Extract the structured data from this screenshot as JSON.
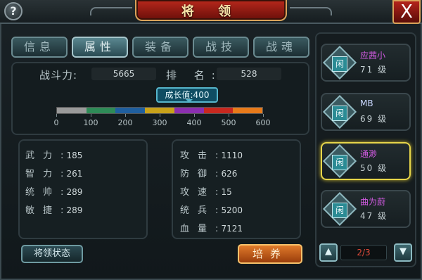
{
  "header": {
    "title": "将 领",
    "help_label": "?",
    "close_label": "X"
  },
  "tabs": [
    {
      "label": "信息"
    },
    {
      "label": "属性"
    },
    {
      "label": "装备"
    },
    {
      "label": "战技"
    },
    {
      "label": "战魂"
    }
  ],
  "summary": {
    "power_label": "战斗力:",
    "power_value": "5665",
    "rank_label": "排 名:",
    "rank_value": "528"
  },
  "growth": {
    "tooltip": "成长值:400",
    "value": 400,
    "max": 600,
    "ticks": [
      "0",
      "100",
      "200",
      "300",
      "400",
      "500",
      "600"
    ],
    "segment_colors": [
      "#9a9a9a",
      "#2e8b57",
      "#1f5f9f",
      "#c8a21a",
      "#8b2fb0",
      "#c8281f",
      "#e87a1a"
    ]
  },
  "left_stats": [
    {
      "label": "武力",
      "value": "185"
    },
    {
      "label": "智力",
      "value": "261"
    },
    {
      "label": "统帅",
      "value": "289"
    },
    {
      "label": "敏捷",
      "value": "289"
    }
  ],
  "right_stats": [
    {
      "label": "攻击",
      "value": "1110"
    },
    {
      "label": "防御",
      "value": "626"
    },
    {
      "label": "攻速",
      "value": "15"
    },
    {
      "label": "统兵",
      "value": "5200"
    },
    {
      "label": "血量",
      "value": "7121"
    }
  ],
  "buttons": {
    "status": "将领状态",
    "cultivate": "培养"
  },
  "generals": [
    {
      "name": "应茜小",
      "level": "71 级",
      "avatar": "闲",
      "name_color": "#d05ae0"
    },
    {
      "name": "MB",
      "level": "69 级",
      "avatar": "闲",
      "name_color": "#c9d7ff"
    },
    {
      "name": "通渺",
      "level": "50 级",
      "avatar": "闲",
      "name_color": "#d05ae0",
      "selected": true
    },
    {
      "name": "曲为蔚",
      "level": "47 级",
      "avatar": "闲",
      "name_color": "#d05ae0"
    }
  ],
  "pager": {
    "text": "2/3",
    "up_icon": "chevron-up-icon",
    "down_icon": "chevron-down-icon"
  }
}
